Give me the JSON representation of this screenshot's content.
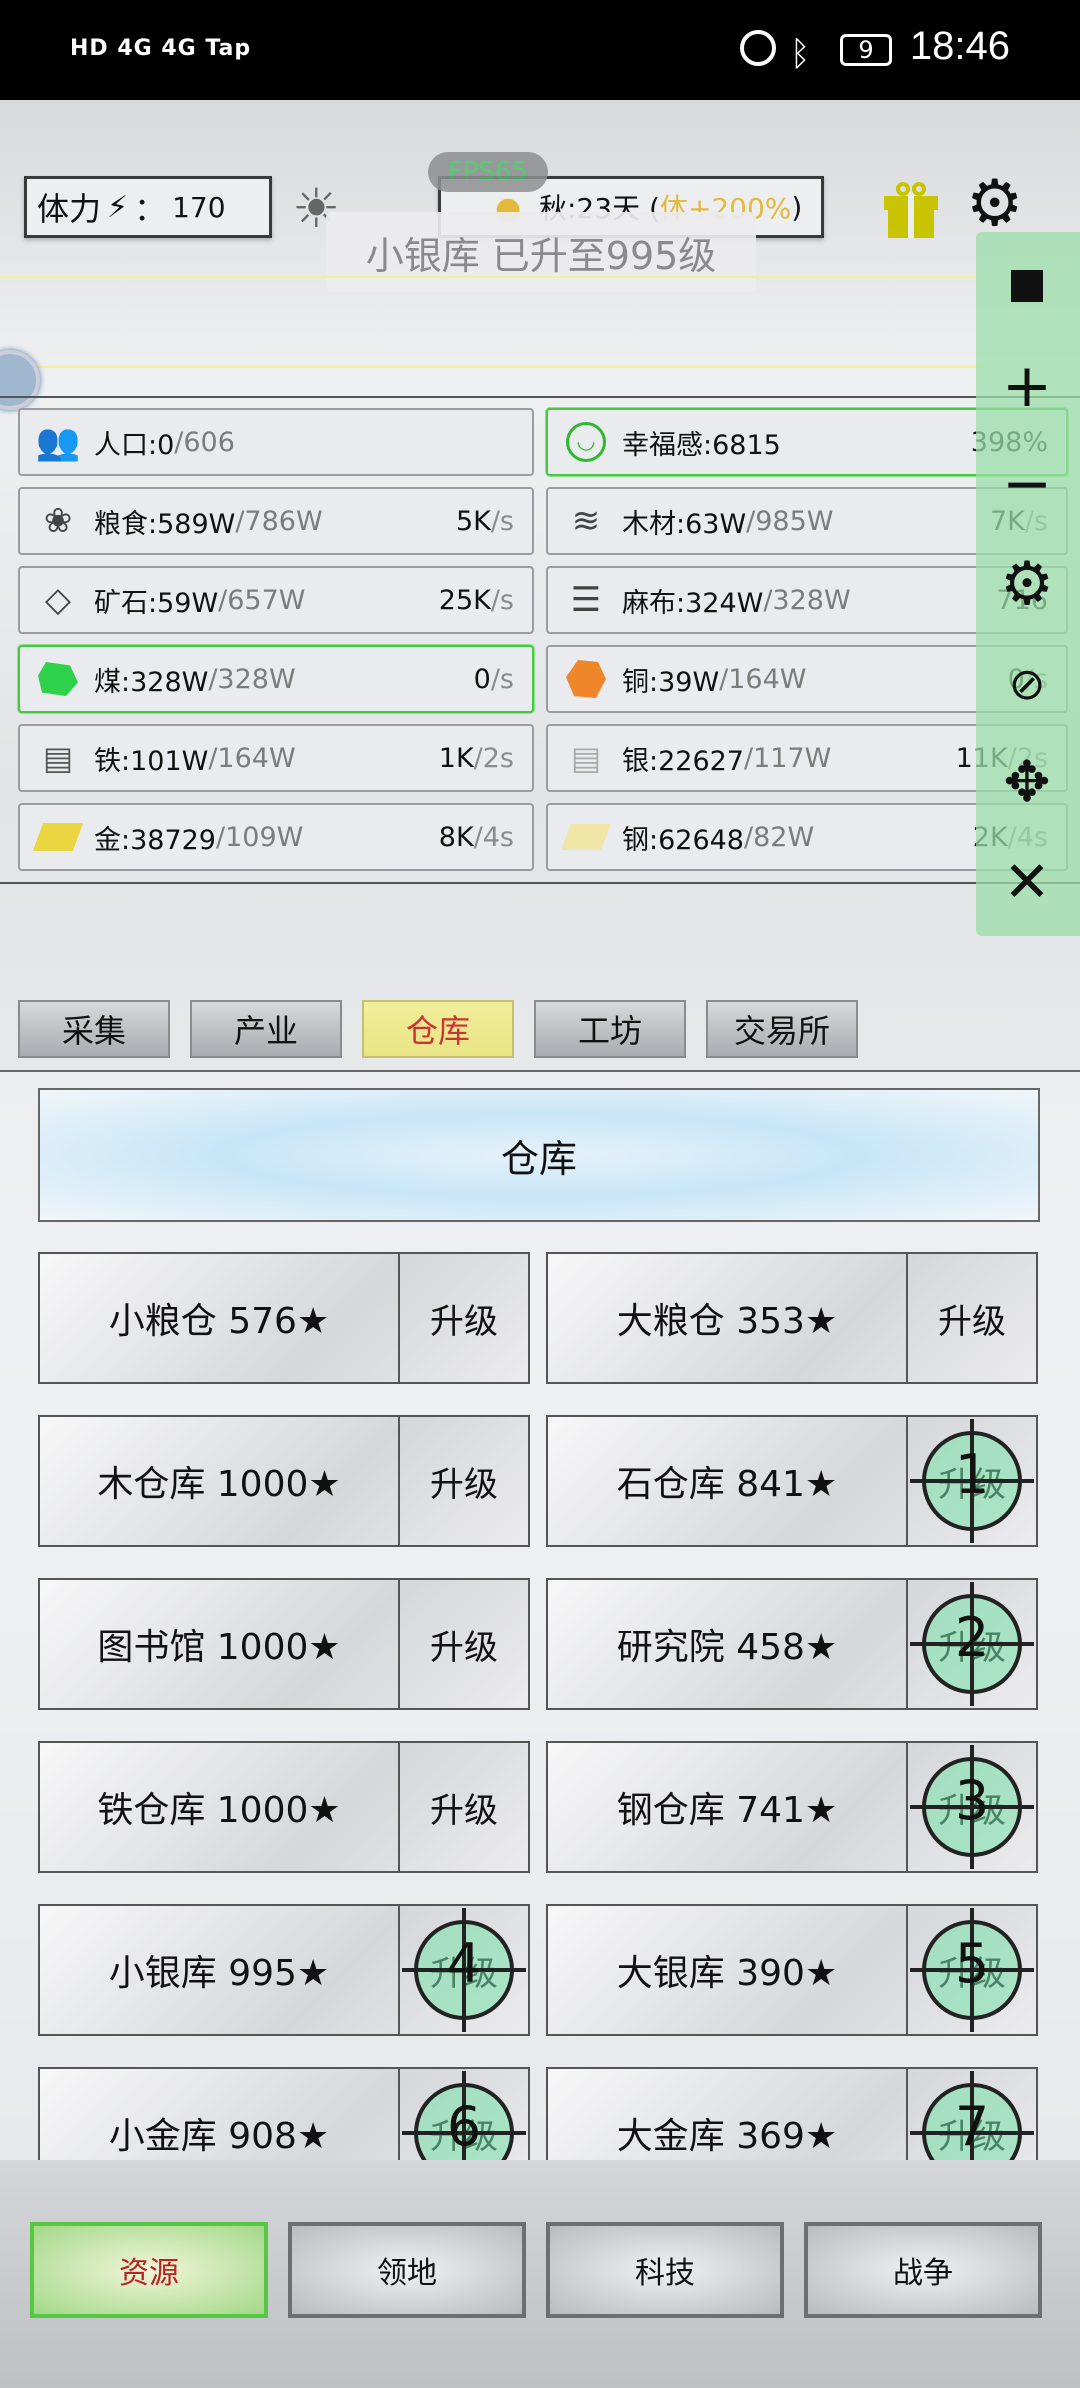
{
  "status_bar": {
    "left": "HD 4G 4G Tap",
    "battery": "9",
    "time": "18:46"
  },
  "top": {
    "stamina_label": "体力",
    "stamina_sep": "：",
    "stamina_value": "170",
    "fps": "FPS65",
    "season_prefix": "秋:23天 (",
    "season_bonus": "体+200%",
    "season_suffix": ")",
    "toast": "小银库 已升至995级"
  },
  "resources": [
    {
      "id": "population",
      "icon": "people-icon",
      "name": "人口:0",
      "max": "/606",
      "rate": "",
      "unit": "",
      "green": false
    },
    {
      "id": "happiness",
      "icon": "smile-icon",
      "name": "幸福感:6815",
      "max": "",
      "rate": "398%",
      "unit": "",
      "green": true
    },
    {
      "id": "grain",
      "icon": "grain-icon",
      "name": "粮食:589W",
      "max": "/786W",
      "rate": "5K",
      "unit": "/s",
      "green": false
    },
    {
      "id": "wood",
      "icon": "wood-icon",
      "name": "木材:63W",
      "max": "/985W",
      "rate": "7K",
      "unit": "/s",
      "green": false
    },
    {
      "id": "ore",
      "icon": "ore-icon",
      "name": "矿石:59W",
      "max": "/657W",
      "rate": "25K",
      "unit": "/s",
      "green": false
    },
    {
      "id": "linen",
      "icon": "linen-icon",
      "name": "麻布:324W",
      "max": "/328W",
      "rate": "716",
      "unit": "",
      "green": false
    },
    {
      "id": "coal",
      "icon": "coal-icon",
      "name": "煤:328W",
      "max": "/328W",
      "rate": "0",
      "unit": "/s",
      "green": true
    },
    {
      "id": "copper",
      "icon": "copper-icon",
      "name": "铜:39W",
      "max": "/164W",
      "rate": "0",
      "unit": "/s",
      "green": false
    },
    {
      "id": "iron",
      "icon": "iron-icon",
      "name": "铁:101W",
      "max": "/164W",
      "rate": "1K",
      "unit": "/2s",
      "green": false
    },
    {
      "id": "silver",
      "icon": "silver-icon",
      "name": "银:22627",
      "max": "/117W",
      "rate": "11K",
      "unit": "/2s",
      "green": false
    },
    {
      "id": "gold",
      "icon": "gold-icon",
      "name": "金:38729",
      "max": "/109W",
      "rate": "8K",
      "unit": "/4s",
      "green": false
    },
    {
      "id": "steel",
      "icon": "steel-icon",
      "name": "钢:62648",
      "max": "/82W",
      "rate": "2K",
      "unit": "/4s",
      "green": false
    }
  ],
  "tabs": [
    "采集",
    "产业",
    "仓库",
    "工坊",
    "交易所"
  ],
  "active_tab": "仓库",
  "section_title": "仓库",
  "upgrade_label": "升级",
  "warehouses": [
    {
      "label": "小粮仓  576★",
      "marker": ""
    },
    {
      "label": "大粮仓  353★",
      "marker": ""
    },
    {
      "label": "木仓库  1000★",
      "marker": ""
    },
    {
      "label": "石仓库  841★",
      "marker": "1"
    },
    {
      "label": "图书馆  1000★",
      "marker": ""
    },
    {
      "label": "研究院  458★",
      "marker": "2"
    },
    {
      "label": "铁仓库  1000★",
      "marker": ""
    },
    {
      "label": "钢仓库  741★",
      "marker": "3"
    },
    {
      "label": "小银库  995★",
      "marker": "4"
    },
    {
      "label": "大银库  390★",
      "marker": "5"
    },
    {
      "label": "小金库  908★",
      "marker": "6"
    },
    {
      "label": "大金库  369★",
      "marker": "7"
    }
  ],
  "bottom_nav": [
    "资源",
    "领地",
    "科技",
    "战争"
  ],
  "active_bottom": "资源",
  "side_toolbar": [
    "stop-icon",
    "plus-icon",
    "minus-icon",
    "gear-icon",
    "eye-off-icon",
    "move-icon",
    "close-icon"
  ],
  "colors": {
    "active_border": "#55c740",
    "side_toolbar": "#a8e6b2",
    "gift": "#c9c400",
    "season_bonus": "#e5b93a"
  }
}
